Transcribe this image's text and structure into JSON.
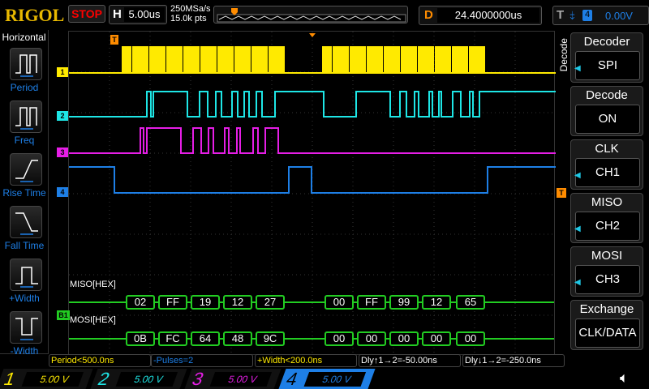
{
  "header": {
    "logo": "RIGOL",
    "run_state": "STOP",
    "h_label": "H",
    "timebase": "5.00us",
    "sample_rate": "250MSa/s",
    "memory_depth": "15.0k pts",
    "d_label": "D",
    "delay": "24.4000000us",
    "t_label": "T",
    "trigger_source": "4",
    "trigger_level": "0.00V"
  },
  "left_menu": {
    "title": "Horizontal",
    "items": [
      {
        "label": "Period",
        "icon": "period-icon"
      },
      {
        "label": "Freq",
        "icon": "frequency-icon"
      },
      {
        "label": "Rise Time",
        "icon": "rise-time-icon"
      },
      {
        "label": "Fall Time",
        "icon": "fall-time-icon"
      },
      {
        "label": "+Width",
        "icon": "positive-width-icon"
      },
      {
        "label": "-Width",
        "icon": "negative-width-icon"
      }
    ]
  },
  "right_menu": {
    "tab": "Decode",
    "items": [
      {
        "title": "Decoder",
        "value": "SPI"
      },
      {
        "title": "Decode",
        "value": "ON"
      },
      {
        "title": "CLK",
        "value": "CH1"
      },
      {
        "title": "MISO",
        "value": "CH2"
      },
      {
        "title": "MOSI",
        "value": "CH3"
      },
      {
        "title": "Exchange",
        "value": "CLK/DATA"
      }
    ]
  },
  "channel_markers": [
    "1",
    "2",
    "3",
    "4"
  ],
  "bus_marker": "B1",
  "trigger_marker": "T",
  "decode": {
    "miso_label": "MISO[HEX]",
    "mosi_label": "MOSI[HEX]",
    "miso": [
      "02",
      "FF",
      "19",
      "12",
      "27",
      "00",
      "FF",
      "99",
      "12",
      "65"
    ],
    "mosi": [
      "0B",
      "FC",
      "64",
      "48",
      "9C",
      "00",
      "00",
      "00",
      "00",
      "00"
    ]
  },
  "measurements": [
    "Period<500.0ns",
    "-Pulses=2",
    "+Width<200.0ns",
    "Dly↑1→2=-50.00ns",
    "Dly↓1→2=-250.0ns"
  ],
  "channels": [
    {
      "num": "1",
      "scale": "5.00 V",
      "color": "#ffea00"
    },
    {
      "num": "2",
      "scale": "5.00 V",
      "color": "#1ee6e6"
    },
    {
      "num": "3",
      "scale": "5.00 V",
      "color": "#e61ee6"
    },
    {
      "num": "4",
      "scale": "5.00 V",
      "color": "#1e7fe6"
    }
  ],
  "colors": {
    "ch1": "#ffea00",
    "ch2": "#1ee6e6",
    "ch3": "#e61ee6",
    "ch4": "#1e7fe6",
    "bus": "#22cc22",
    "trigger": "#ff8c00"
  }
}
